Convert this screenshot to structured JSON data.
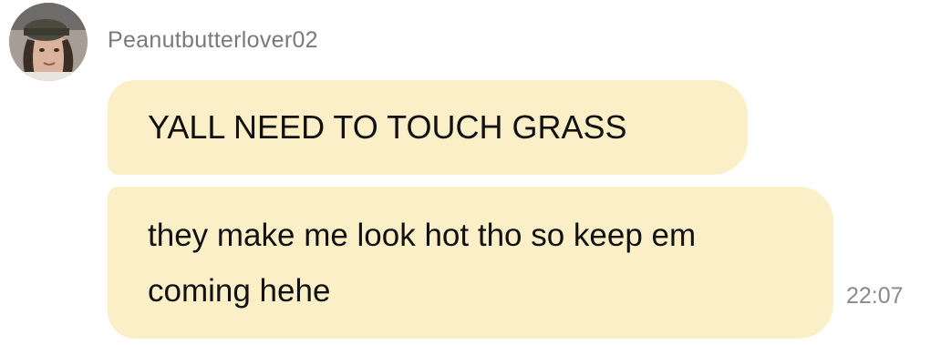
{
  "sender": {
    "username": "Peanutbutterlover02",
    "avatar_icon": "user-avatar-photo"
  },
  "messages": [
    {
      "text": "YALL NEED TO TOUCH GRASS"
    },
    {
      "text": "they make me look hot tho so keep em coming hehe",
      "time": "22:07"
    }
  ],
  "colors": {
    "bubble": "#fbefc8",
    "username": "#7a7a7a",
    "timestamp": "#8a8a8a"
  }
}
